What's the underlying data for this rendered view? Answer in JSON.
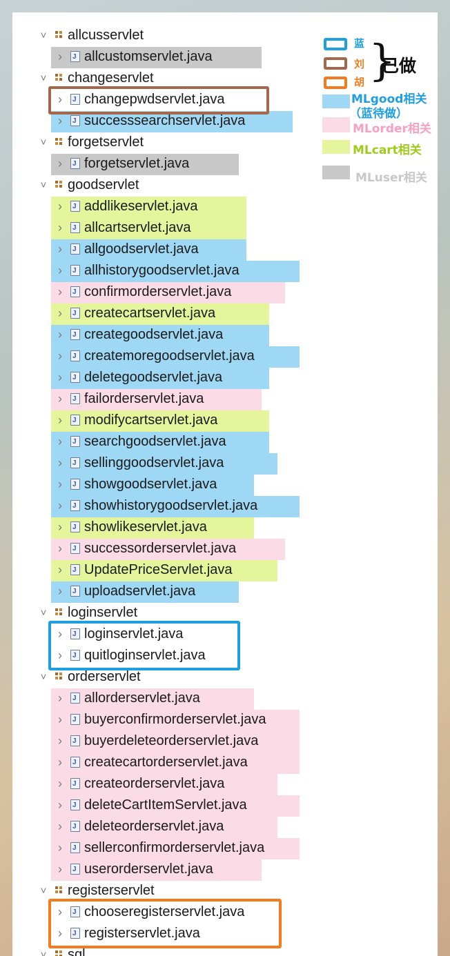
{
  "colors": {
    "blue": "#1f9fe0",
    "brown": "#a5674c",
    "orange": "#f47c1e",
    "mlgood": "#9fd8f4",
    "mlorder": "#fbdbe6",
    "mlcart": "#e4f59c",
    "mluser": "#c8c8c8"
  },
  "tree": [
    {
      "type": "package",
      "label": "allcusservlet",
      "expanded": true
    },
    {
      "type": "file",
      "label": "allcustomservlet.java",
      "cat": "mluser"
    },
    {
      "type": "package",
      "label": "changeservlet",
      "expanded": true
    },
    {
      "type": "file",
      "label": "changepwdservlet.java",
      "cat": "none"
    },
    {
      "type": "file",
      "label": "successsearchservlet.java",
      "cat": "mlgood"
    },
    {
      "type": "package",
      "label": "forgetservlet",
      "expanded": true
    },
    {
      "type": "file",
      "label": "forgetservlet.java",
      "cat": "mluser"
    },
    {
      "type": "package",
      "label": "goodservlet",
      "expanded": true
    },
    {
      "type": "file",
      "label": "addlikeservlet.java",
      "cat": "mlcart"
    },
    {
      "type": "file",
      "label": "allcartservlet.java",
      "cat": "mlcart"
    },
    {
      "type": "file",
      "label": "allgoodservlet.java",
      "cat": "mlgood"
    },
    {
      "type": "file",
      "label": "allhistorygoodservlet.java",
      "cat": "mlgood"
    },
    {
      "type": "file",
      "label": "confirmorderservlet.java",
      "cat": "mlorder"
    },
    {
      "type": "file",
      "label": "createcartservlet.java",
      "cat": "mlcart"
    },
    {
      "type": "file",
      "label": "creategoodservlet.java",
      "cat": "mlgood"
    },
    {
      "type": "file",
      "label": "createmoregoodservlet.java",
      "cat": "mlgood"
    },
    {
      "type": "file",
      "label": "deletegoodservlet.java",
      "cat": "mlgood"
    },
    {
      "type": "file",
      "label": "failorderservlet.java",
      "cat": "mlorder"
    },
    {
      "type": "file",
      "label": "modifycartservlet.java",
      "cat": "mlcart"
    },
    {
      "type": "file",
      "label": "searchgoodservlet.java",
      "cat": "mlgood"
    },
    {
      "type": "file",
      "label": "sellinggoodservlet.java",
      "cat": "mlgood"
    },
    {
      "type": "file",
      "label": "showgoodservlet.java",
      "cat": "mlgood"
    },
    {
      "type": "file",
      "label": "showhistorygoodservlet.java",
      "cat": "mlgood"
    },
    {
      "type": "file",
      "label": "showlikeservlet.java",
      "cat": "mlcart"
    },
    {
      "type": "file",
      "label": "successorderservlet.java",
      "cat": "mlorder"
    },
    {
      "type": "file",
      "label": "UpdatePriceServlet.java",
      "cat": "mlcart"
    },
    {
      "type": "file",
      "label": "uploadservlet.java",
      "cat": "mlgood"
    },
    {
      "type": "package",
      "label": "loginservlet",
      "expanded": true
    },
    {
      "type": "file",
      "label": "loginservlet.java",
      "cat": "none"
    },
    {
      "type": "file",
      "label": "quitloginservlet.java",
      "cat": "none"
    },
    {
      "type": "package",
      "label": "orderservlet",
      "expanded": true
    },
    {
      "type": "file",
      "label": "allorderservlet.java",
      "cat": "mlorder"
    },
    {
      "type": "file",
      "label": "buyerconfirmorderservlet.java",
      "cat": "mlorder"
    },
    {
      "type": "file",
      "label": "buyerdeleteorderservlet.java",
      "cat": "mlorder"
    },
    {
      "type": "file",
      "label": "createcartorderservlet.java",
      "cat": "mlorder"
    },
    {
      "type": "file",
      "label": "createorderservlet.java",
      "cat": "mlorder"
    },
    {
      "type": "file",
      "label": "deleteCartItemServlet.java",
      "cat": "mlorder"
    },
    {
      "type": "file",
      "label": "deleteorderservlet.java",
      "cat": "mlorder"
    },
    {
      "type": "file",
      "label": "sellerconfirmorderservlet.java",
      "cat": "mlorder"
    },
    {
      "type": "file",
      "label": "userorderservlet.java",
      "cat": "mlorder"
    },
    {
      "type": "package",
      "label": "registerservlet",
      "expanded": true
    },
    {
      "type": "file",
      "label": "chooseregisterservlet.java",
      "cat": "none"
    },
    {
      "type": "file",
      "label": "registerservlet.java",
      "cat": "none"
    },
    {
      "type": "package",
      "label": "sql",
      "expanded": true
    }
  ],
  "legend": {
    "blue_label": "蓝",
    "brown_label": "刘",
    "orange_label": "胡",
    "done_label": "已做",
    "mlgood_label": "MLgood相关",
    "mlgood_sub": "（蓝待做）",
    "mlorder_label": "MLorder相关",
    "mlcart_label": "MLcart相关",
    "mluser_label": "MLuser相关"
  }
}
